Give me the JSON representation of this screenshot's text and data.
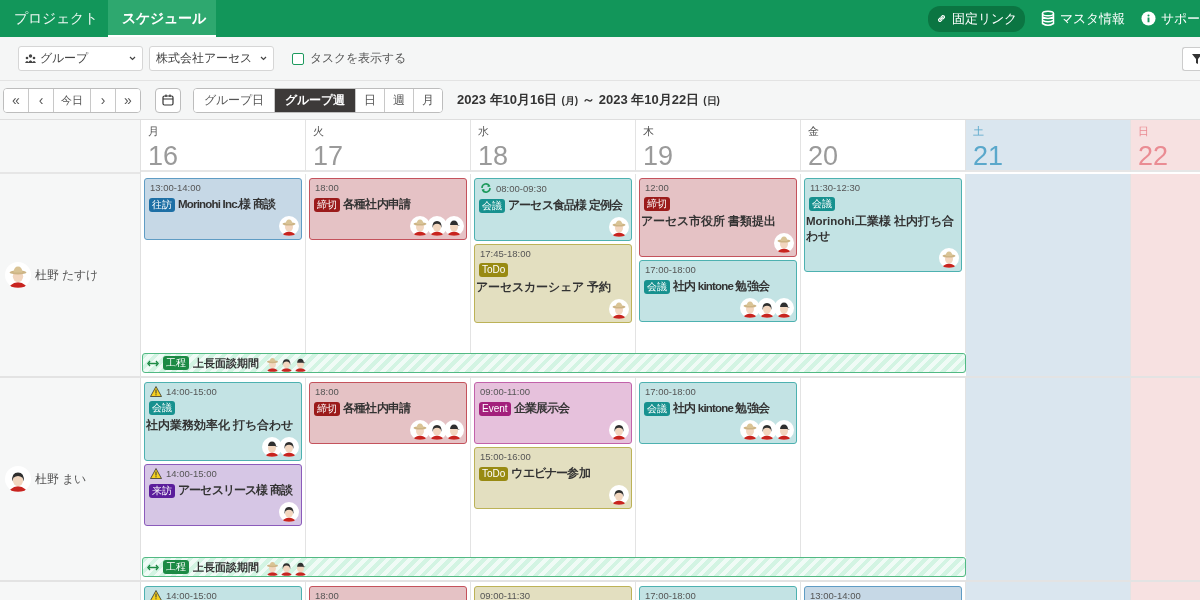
{
  "header": {
    "tabs": [
      {
        "label": "プロジェクト",
        "selected": false
      },
      {
        "label": "スケジュール",
        "selected": true
      }
    ],
    "links": [
      {
        "kind": "permalink",
        "label": "固定リンク"
      },
      {
        "kind": "master",
        "label": "マスタ情報"
      },
      {
        "kind": "support",
        "label": "サポー"
      }
    ]
  },
  "filters": {
    "group_select": "グループ",
    "company_select": "株式会社アーセス",
    "show_tasks": {
      "label": "タスクを表示する",
      "checked": false
    }
  },
  "navigation": {
    "buttons": [
      "«",
      "‹",
      "今日",
      "›",
      "»"
    ],
    "views": [
      {
        "label": "グループ日",
        "selected": false
      },
      {
        "label": "グループ週",
        "selected": true
      },
      {
        "label": "日",
        "selected": false
      },
      {
        "label": "週",
        "selected": false
      },
      {
        "label": "月",
        "selected": false
      }
    ],
    "range": {
      "start": "2023 年10月16日",
      "start_weekday": "(月)",
      "separator": "～",
      "end": "2023 年10月22日",
      "end_weekday": "(日)"
    }
  },
  "days": [
    {
      "weekday": "月",
      "date": "16",
      "kind": "weekday"
    },
    {
      "weekday": "火",
      "date": "17",
      "kind": "weekday"
    },
    {
      "weekday": "水",
      "date": "18",
      "kind": "weekday"
    },
    {
      "weekday": "木",
      "date": "19",
      "kind": "weekday"
    },
    {
      "weekday": "金",
      "date": "20",
      "kind": "weekday"
    },
    {
      "weekday": "土",
      "date": "21",
      "kind": "saturday"
    },
    {
      "weekday": "日",
      "date": "22",
      "kind": "sunday"
    }
  ],
  "people": [
    {
      "name": "杜野 たすけ",
      "avatar": {
        "kind": "hat"
      },
      "cells": [
        [
          {
            "kind": "visit",
            "time": "13:00-14:00",
            "tag": "往訪",
            "title": "Morinohi Inc.様 商談",
            "title_below": false,
            "attendees": [
              {
                "kind": "hat"
              }
            ]
          }
        ],
        [
          {
            "kind": "deadline",
            "time": "18:00",
            "tag": "締切",
            "title": "各種社内申請",
            "title_below": false,
            "attendees": [
              {
                "kind": "hat"
              },
              {
                "kind": "girl"
              },
              {
                "kind": "cap"
              }
            ]
          }
        ],
        [
          {
            "kind": "meeting",
            "recurring": true,
            "time": "08:00-09:30",
            "tag": "会議",
            "title": "アーセス食品様 定例会",
            "title_below": false,
            "attendees": [
              {
                "kind": "hat"
              }
            ]
          },
          {
            "kind": "todo",
            "time": "17:45-18:00",
            "tag": "ToDo",
            "title": "アーセスカーシェア 予約",
            "title_below": true,
            "attendees": [
              {
                "kind": "hat"
              }
            ]
          }
        ],
        [
          {
            "kind": "deadline",
            "time": "12:00",
            "tag": "締切",
            "title": "アーセス市役所 書類提出",
            "title_below": true,
            "attendees": [
              {
                "kind": "hat"
              }
            ]
          },
          {
            "kind": "meeting",
            "time": "17:00-18:00",
            "tag": "会議",
            "title": "社内 kintone 勉強会",
            "title_below": false,
            "attendees": [
              {
                "kind": "hat"
              },
              {
                "kind": "girl"
              },
              {
                "kind": "cap"
              }
            ]
          }
        ],
        [
          {
            "kind": "meeting",
            "time": "11:30-12:30",
            "tag": "会議",
            "title": "Morinohi工業様 社内打ち合わせ",
            "title_below": true,
            "attendees": [
              {
                "kind": "hat"
              }
            ]
          }
        ],
        [],
        []
      ],
      "span": {
        "tag": "工程",
        "title": "上長面談期間",
        "attendees": [
          {
            "kind": "hat"
          },
          {
            "kind": "girl"
          },
          {
            "kind": "cap"
          }
        ]
      }
    },
    {
      "name": "杜野 まい",
      "avatar": {
        "kind": "girl"
      },
      "cells": [
        [
          {
            "kind": "meeting",
            "warning": true,
            "time": "14:00-15:00",
            "tag": "会議",
            "title": "社内業務効率化 打ち合わせ",
            "title_below": true,
            "attendees": [
              {
                "kind": "cap"
              },
              {
                "kind": "girl"
              }
            ]
          },
          {
            "kind": "visitor",
            "warning": true,
            "time": "14:00-15:00",
            "tag": "来訪",
            "title": "アーセスリース様 商談",
            "title_below": false,
            "attendees": [
              {
                "kind": "girl"
              }
            ]
          }
        ],
        [
          {
            "kind": "deadline",
            "time": "18:00",
            "tag": "締切",
            "title": "各種社内申請",
            "title_below": false,
            "attendees": [
              {
                "kind": "hat"
              },
              {
                "kind": "girl"
              },
              {
                "kind": "cap"
              }
            ]
          }
        ],
        [
          {
            "kind": "event",
            "time": "09:00-11:00",
            "tag": "Event",
            "title": "企業展示会",
            "title_below": false,
            "attendees": [
              {
                "kind": "girl"
              }
            ]
          },
          {
            "kind": "todo",
            "time": "15:00-16:00",
            "tag": "ToDo",
            "title": "ウエビナー参加",
            "title_below": false,
            "attendees": [
              {
                "kind": "girl"
              }
            ]
          }
        ],
        [
          {
            "kind": "meeting",
            "time": "17:00-18:00",
            "tag": "会議",
            "title": "社内 kintone 勉強会",
            "title_below": false,
            "attendees": [
              {
                "kind": "hat"
              },
              {
                "kind": "girl"
              },
              {
                "kind": "cap"
              }
            ]
          }
        ],
        [],
        [],
        []
      ],
      "span": {
        "tag": "工程",
        "title": "上長面談期間",
        "attendees": [
          {
            "kind": "hat"
          },
          {
            "kind": "girl"
          },
          {
            "kind": "cap"
          }
        ]
      }
    },
    {
      "cells": [
        [
          {
            "kind": "meeting",
            "warning": true,
            "time": "14:00-15:00"
          }
        ],
        [
          {
            "kind": "deadline",
            "time": "18:00"
          }
        ],
        [
          {
            "kind": "todo",
            "time": "09:00-11:30"
          }
        ],
        [
          {
            "kind": "meeting",
            "time": "17:00-18:00"
          }
        ],
        [
          {
            "kind": "visit",
            "time": "13:00-14:00"
          }
        ],
        [],
        []
      ]
    }
  ]
}
